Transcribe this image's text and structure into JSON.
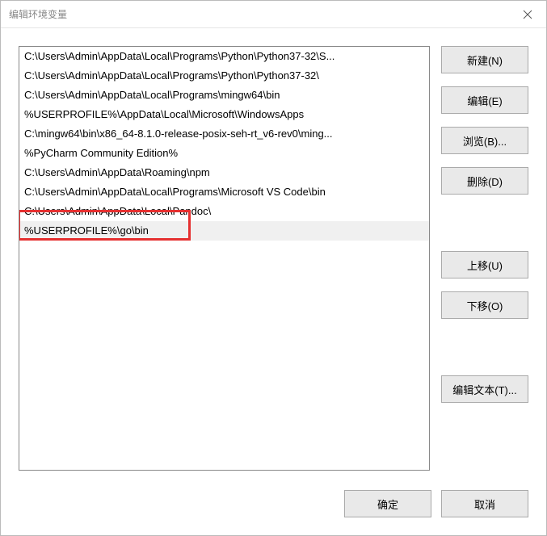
{
  "window": {
    "title": "编辑环境变量"
  },
  "list": {
    "items": [
      "C:\\Users\\Admin\\AppData\\Local\\Programs\\Python\\Python37-32\\S...",
      "C:\\Users\\Admin\\AppData\\Local\\Programs\\Python\\Python37-32\\",
      "C:\\Users\\Admin\\AppData\\Local\\Programs\\mingw64\\bin",
      "%USERPROFILE%\\AppData\\Local\\Microsoft\\WindowsApps",
      "C:\\mingw64\\bin\\x86_64-8.1.0-release-posix-seh-rt_v6-rev0\\ming...",
      "%PyCharm Community Edition%",
      "C:\\Users\\Admin\\AppData\\Roaming\\npm",
      "C:\\Users\\Admin\\AppData\\Local\\Programs\\Microsoft VS Code\\bin",
      "C:\\Users\\Admin\\AppData\\Local\\Pandoc\\",
      "%USERPROFILE%\\go\\bin"
    ],
    "selected_index": 9,
    "highlight_index": 9
  },
  "buttons": {
    "new": "新建(N)",
    "edit": "编辑(E)",
    "browse": "浏览(B)...",
    "delete": "删除(D)",
    "move_up": "上移(U)",
    "move_down": "下移(O)",
    "edit_text": "编辑文本(T)...",
    "ok": "确定",
    "cancel": "取消"
  }
}
